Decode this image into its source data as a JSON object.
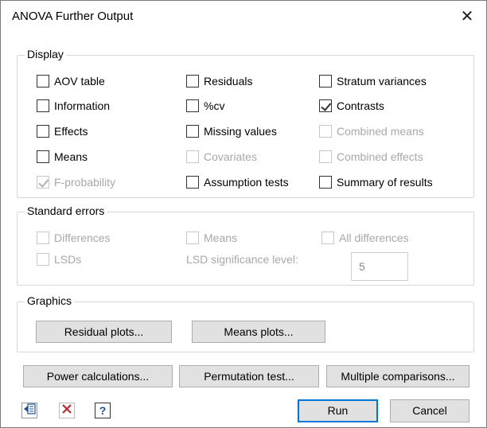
{
  "window": {
    "title": "ANOVA Further Output",
    "close_glyph": "✕"
  },
  "display": {
    "label": "Display",
    "checkboxes": [
      {
        "label": "AOV table",
        "checked": false,
        "enabled": true
      },
      {
        "label": "Information",
        "checked": false,
        "enabled": true
      },
      {
        "label": "Effects",
        "checked": false,
        "enabled": true
      },
      {
        "label": "Means",
        "checked": false,
        "enabled": true
      },
      {
        "label": "F-probability",
        "checked": true,
        "enabled": false
      },
      {
        "label": "Residuals",
        "checked": false,
        "enabled": true
      },
      {
        "label": "%cv",
        "checked": false,
        "enabled": true
      },
      {
        "label": "Missing values",
        "checked": false,
        "enabled": true
      },
      {
        "label": "Covariates",
        "checked": false,
        "enabled": false
      },
      {
        "label": "Assumption tests",
        "checked": false,
        "enabled": true
      },
      {
        "label": "Stratum variances",
        "checked": false,
        "enabled": true
      },
      {
        "label": "Contrasts",
        "checked": true,
        "enabled": true
      },
      {
        "label": "Combined means",
        "checked": false,
        "enabled": false
      },
      {
        "label": "Combined effects",
        "checked": false,
        "enabled": false
      },
      {
        "label": "Summary of results",
        "checked": false,
        "enabled": true
      }
    ]
  },
  "standard_errors": {
    "label": "Standard errors",
    "differences": "Differences",
    "means": "Means",
    "all_differences": "All differences",
    "lsds": "LSDs",
    "lsd_level_label": "LSD significance level:",
    "lsd_level_value": "5"
  },
  "graphics": {
    "label": "Graphics",
    "residual_plots": "Residual plots...",
    "means_plots": "Means plots..."
  },
  "actions": {
    "power_calculations": "Power calculations...",
    "permutation_test": "Permutation test...",
    "multiple_comparisons": "Multiple comparisons...",
    "run": "Run",
    "cancel": "Cancel"
  },
  "icons": {
    "transfer": "transfer-icon",
    "clear": "clear-icon",
    "help": "help-icon",
    "help_glyph": "?"
  }
}
